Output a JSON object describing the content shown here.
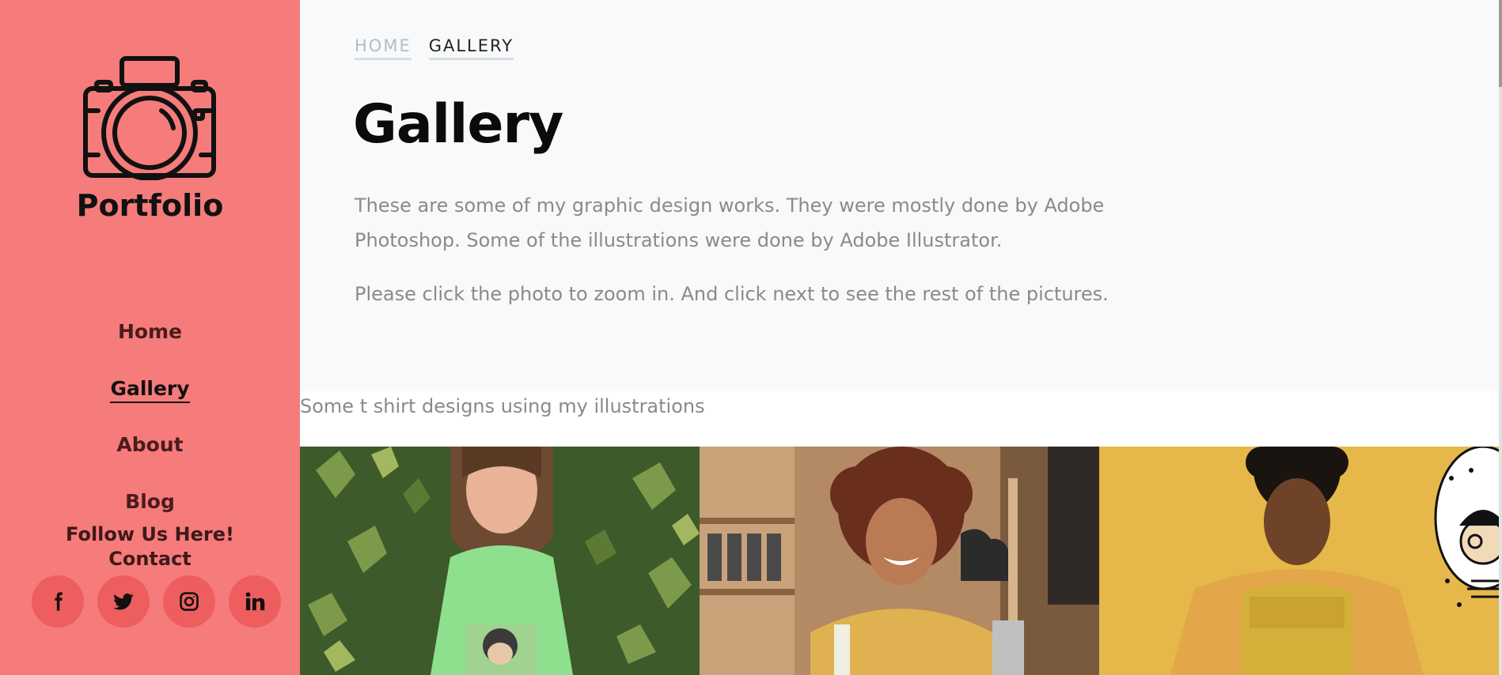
{
  "sidebar": {
    "brand": "Portfolio",
    "logo_icon": "camera-icon",
    "nav": [
      {
        "label": "Home",
        "active": false
      },
      {
        "label": "Gallery",
        "active": true
      },
      {
        "label": "About",
        "active": false
      },
      {
        "label": "Blog",
        "active": false
      }
    ],
    "follow_label": "Follow Us Here!",
    "contact_label": "Contact",
    "socials": [
      "facebook-icon",
      "twitter-icon",
      "instagram-icon",
      "linkedin-icon"
    ]
  },
  "breadcrumb": {
    "home": "Home",
    "current": "Gallery"
  },
  "page": {
    "title": "Gallery",
    "description": "These are some of my graphic design works. They were mostly done by Adobe Photoshop. Some of the illustrations were done by Adobe Illustrator.",
    "instructions": "Please click the photo to zoom in. And click next to see the rest of the pictures."
  },
  "gallery": {
    "section_label": "Some t shirt designs using my illustrations",
    "photos": [
      {
        "name": "photo-woman-green-tshirt"
      },
      {
        "name": "photo-woman-curly-hair-yellow-tshirt"
      },
      {
        "name": "photo-woman-yellow-background"
      }
    ]
  },
  "colors": {
    "sidebar_bg": "#f67b7b",
    "social_bg": "#ee5e5e",
    "hero_bg": "#f8f9fa",
    "text_muted": "#8a8a8a"
  }
}
